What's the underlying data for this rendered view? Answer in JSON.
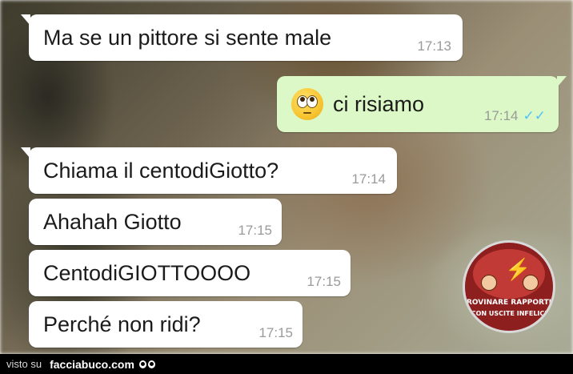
{
  "messages": [
    {
      "text": "Ma se un pittore si sente male",
      "time": "17:13",
      "dir": "in"
    },
    {
      "text": "ci risiamo",
      "time": "17:14",
      "dir": "out",
      "emoji": "face-with-rolling-eyes-icon",
      "status": "double-check-read"
    },
    {
      "text": "Chiama il centodiGiotto?",
      "time": "17:14",
      "dir": "in"
    },
    {
      "text": "Ahahah Giotto",
      "time": "17:15",
      "dir": "in"
    },
    {
      "text": "CentodiGIOTTOOOO",
      "time": "17:15",
      "dir": "in"
    },
    {
      "text": "Perché non ridi?",
      "time": "17:15",
      "dir": "in"
    }
  ],
  "watermark": {
    "line1": "ROVINARE RAPPORTI",
    "line2": "CON USCITE INFELICI"
  },
  "footer": {
    "visto": "visto su",
    "site": "facciabuco.com"
  },
  "colors": {
    "incoming": "#ffffff",
    "outgoing": "#dcf8c6",
    "read_ticks": "#4fc3f7",
    "footer_bg": "#000000",
    "logo": "#8e1f1f"
  }
}
